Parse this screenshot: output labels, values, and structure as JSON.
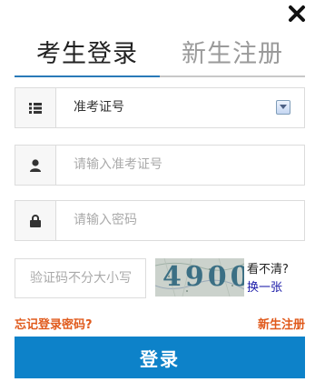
{
  "tabs": {
    "login": "考生登录",
    "register": "新生注册"
  },
  "form": {
    "id_type": {
      "selected": "准考证号",
      "icon": "list-icon"
    },
    "username": {
      "placeholder": "请输入准考证号",
      "icon": "user-icon"
    },
    "password": {
      "placeholder": "请输入密码",
      "icon": "lock-icon"
    },
    "captcha": {
      "placeholder": "验证码不分大小写",
      "image_text": "4900",
      "unclear_label": "看不清?",
      "refresh_label": "换一张"
    }
  },
  "links": {
    "forgot": "忘记登录密码?",
    "register": "新生注册"
  },
  "submit_label": "登录",
  "colors": {
    "accent": "#0d82c9",
    "tab_underline": "#2a7ab8",
    "link_orange": "#e05a1c",
    "refresh_blue": "#1a1aa8"
  }
}
